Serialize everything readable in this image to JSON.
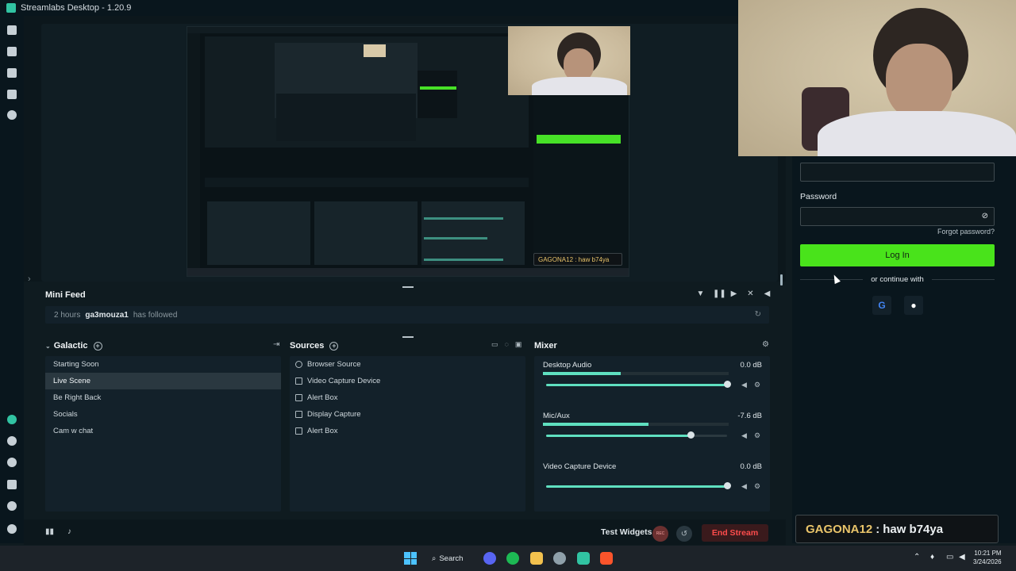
{
  "window": {
    "title": "Streamlabs Desktop - 1.20.9"
  },
  "left_nav": {
    "icons": [
      "editor-icon",
      "themes-icon",
      "store-icon",
      "media-icon",
      "play-icon",
      "highlighter-icon",
      "apps-icon",
      "apps-icon-2",
      "magic-icon",
      "settings-icon",
      "profile-icon"
    ]
  },
  "preview": {
    "chat_overlay_mini": "GAGONA12 : haw b74ya"
  },
  "mini_feed": {
    "title": "Mini Feed",
    "event": {
      "time": "2 hours",
      "user": "ga3mouza1",
      "action": "has followed"
    }
  },
  "scenes": {
    "title": "Galactic",
    "items": [
      "Starting Soon",
      "Live Scene",
      "Be Right Back",
      "Socials",
      "Cam w chat"
    ],
    "active_index": 1
  },
  "sources": {
    "title": "Sources",
    "items": [
      "Browser Source",
      "Video Capture Device",
      "Alert Box",
      "Display Capture",
      "Alert Box"
    ]
  },
  "mixer": {
    "title": "Mixer",
    "channels": [
      {
        "name": "Desktop Audio",
        "db": "0.0 dB",
        "meter": 0.42,
        "fader": 1.0
      },
      {
        "name": "Mic/Aux",
        "db": "-7.6 dB",
        "meter": 0.57,
        "fader": 0.8
      },
      {
        "name": "Video Capture Device",
        "db": "0.0 dB",
        "meter": 0.0,
        "fader": 1.0
      }
    ]
  },
  "bottom_bar": {
    "test_widgets": "Test Widgets",
    "rec_label": "REC",
    "end_stream": "End Stream"
  },
  "login": {
    "password_label": "Password",
    "forgot": "Forgot password?",
    "login_button": "Log In",
    "continue_with": "or continue with"
  },
  "chat_overlay": {
    "user": "GAGONA12",
    "separator": ":",
    "message": "haw b74ya"
  },
  "taskbar": {
    "search": "Search",
    "time": "10:21 PM",
    "date": "3/24/2026"
  },
  "colors": {
    "accent": "#31c3a2",
    "login_green": "#49e31b",
    "end_stream_red": "#ff4c4c",
    "chat_name": "#e9c46a"
  }
}
